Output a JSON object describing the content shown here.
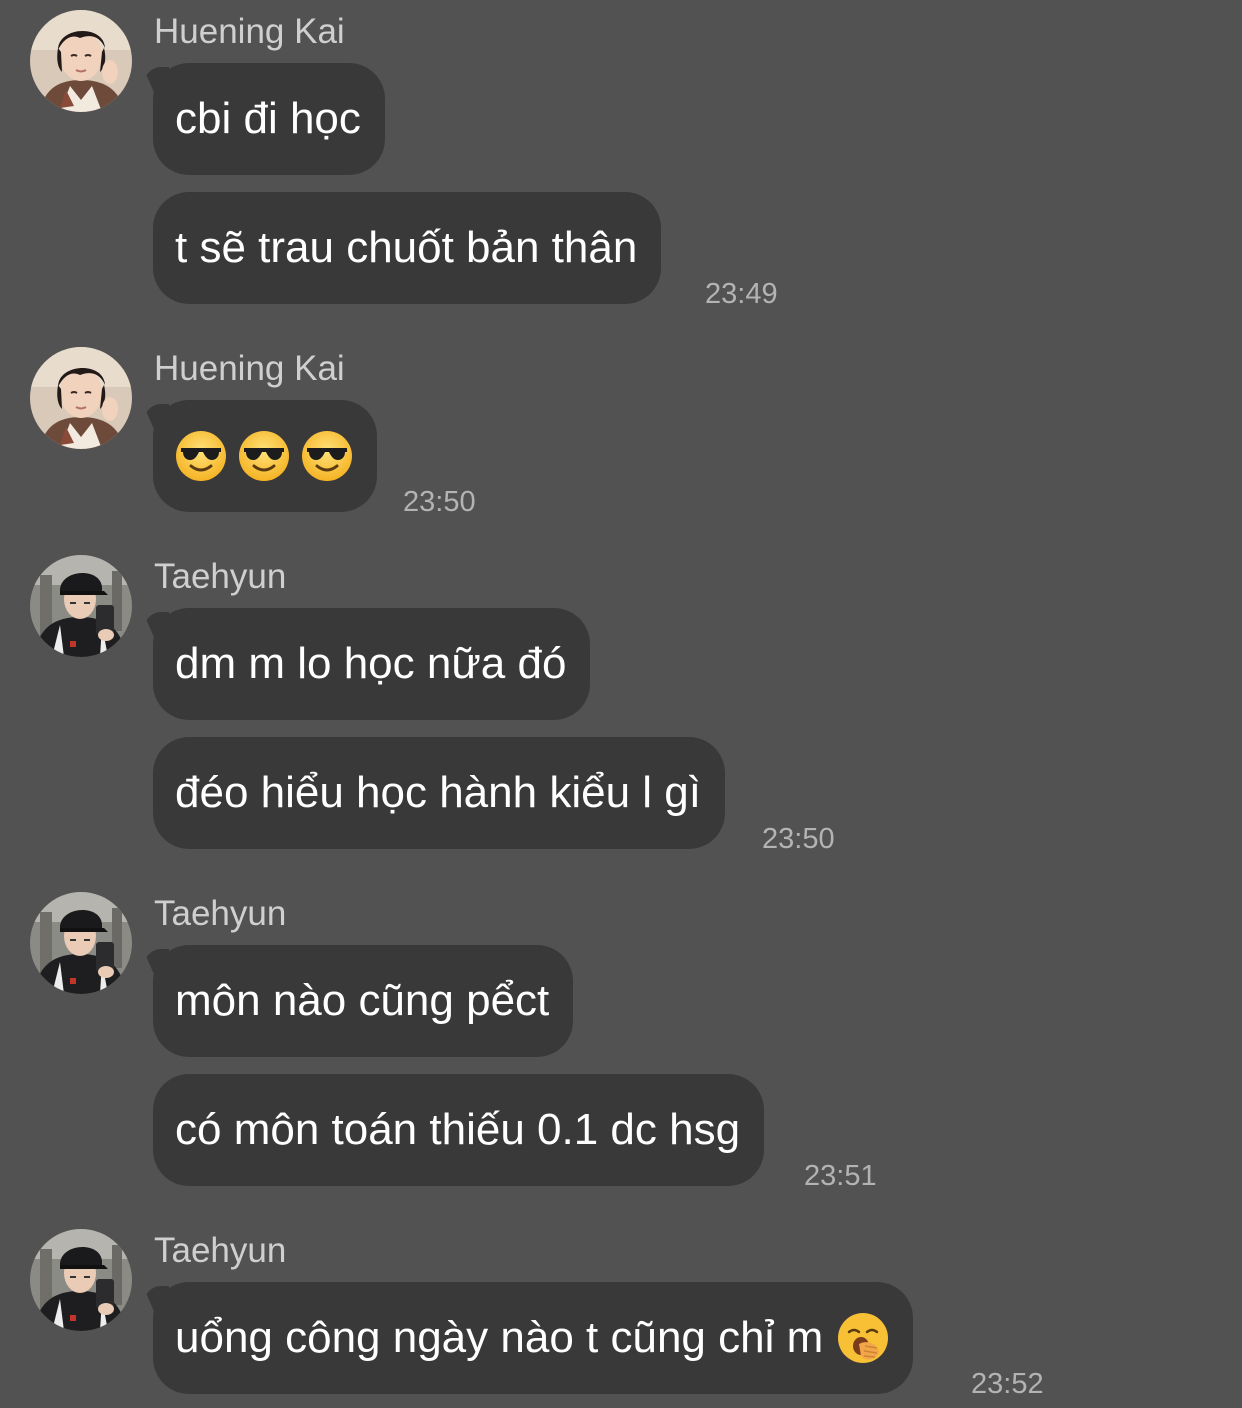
{
  "messages": [
    {
      "sender": "Huening Kai",
      "avatar_icon": "huening-kai-avatar",
      "bubbles": [
        "cbi đi học",
        "t sẽ trau chuốt bản thân"
      ],
      "time": "23:49"
    },
    {
      "sender": "Huening Kai",
      "avatar_icon": "huening-kai-avatar",
      "emoji": [
        "smiling-face-with-sunglasses",
        "smiling-face-with-sunglasses",
        "smiling-face-with-sunglasses"
      ],
      "time": "23:50"
    },
    {
      "sender": "Taehyun",
      "avatar_icon": "taehyun-avatar",
      "bubbles": [
        "dm m lo học nữa đó",
        "đéo hiểu học hành kiểu l gì"
      ],
      "time": "23:50"
    },
    {
      "sender": "Taehyun",
      "avatar_icon": "taehyun-avatar",
      "bubbles": [
        "môn nào cũng pểct",
        "có môn toán thiếu 0.1 dc hsg"
      ],
      "time": "23:51"
    },
    {
      "sender": "Taehyun",
      "avatar_icon": "taehyun-avatar",
      "bubbles": [
        "uổng công ngày nào t cũng chỉ m"
      ],
      "bubble_emoji": "yawning-face",
      "time": "23:52"
    }
  ],
  "colors": {
    "background": "#535253",
    "bubble": "#3a393a",
    "sender": "#cfcfcf",
    "message_text": "#ffffff",
    "timestamp": "#b3b3b3"
  }
}
